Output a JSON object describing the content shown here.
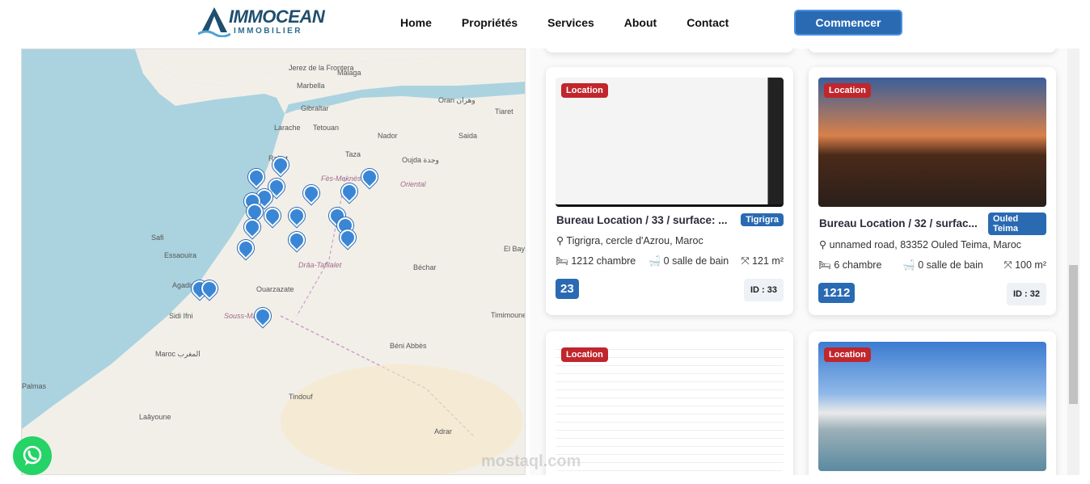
{
  "header": {
    "logo_main": "IMMOCEAN",
    "logo_sub": "IMMOBILIER",
    "nav": [
      "Home",
      "Propriétés",
      "Services",
      "About",
      "Contact"
    ],
    "cta": "Commencer"
  },
  "map": {
    "labels": [
      "Jerez de la Frontera",
      "Marbella",
      "Málaga",
      "Gibraltar",
      "Oran وهران",
      "Tiaret",
      "Larache",
      "Tetouan",
      "Nador",
      "Saida",
      "Rabat",
      "Taza",
      "Oujda وجدة",
      "Fès-Meknès",
      "Oriental",
      "Safi",
      "Essaouira",
      "Agadir",
      "Ouarzazate",
      "Drâa-Tafilalet",
      "Béchar",
      "Sidi Ifni",
      "Souss-Massa",
      "Timimoune",
      "Béni Abbès",
      "Tindouf",
      "Maroc المغرب",
      "Palmas",
      "Laâyoune",
      "Adrar",
      "El Bayadh"
    ]
  },
  "cards": [
    {
      "tag": "Location",
      "title": "Bureau Location / 33 / surface: ...",
      "city": "Tigrigra",
      "address": "Tigrigra, cercle d'Azrou, Maroc",
      "rooms": "1212 chambre",
      "baths": "0 salle de bain",
      "area": "121 m²",
      "price": "23",
      "id": "ID : 33"
    },
    {
      "tag": "Location",
      "title": "Bureau Location / 32 / surfac...",
      "city": "Ouled Teima",
      "address": "unnamed road, 83352 Ouled Teima, Maroc",
      "rooms": "6 chambre",
      "baths": "0 salle de bain",
      "area": "100 m²",
      "price": "1212",
      "id": "ID : 32"
    },
    {
      "tag": "Location"
    },
    {
      "tag": "Location"
    }
  ],
  "watermark": "mostaql.com"
}
